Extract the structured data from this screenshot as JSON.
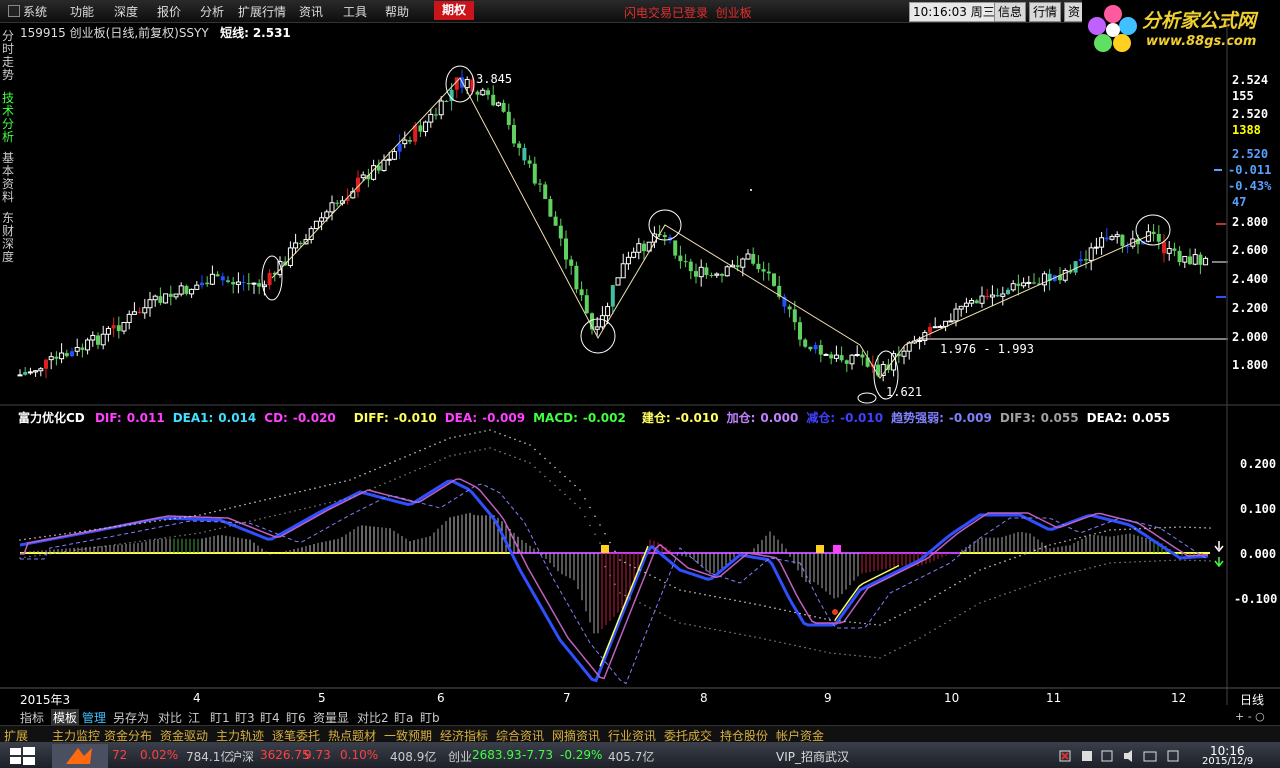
{
  "menu": [
    "系统",
    "功能",
    "深度",
    "报价",
    "分析",
    "扩展行情",
    "资讯",
    "工具",
    "帮助"
  ],
  "menu_qiquan": "期权",
  "status_login": "闪电交易已登录",
  "status_board": "创业板",
  "clock_time": "10:16:03",
  "clock_day": "周三",
  "top_buttons": [
    "信息",
    "行情",
    "资"
  ],
  "logo": {
    "title": "分析家公式网",
    "url": "www.88gs.com"
  },
  "left_tabs": [
    "分时走势",
    "技术分析",
    "基本资料",
    "东财深度"
  ],
  "header": {
    "code": "159915",
    "name": "创业板(日线,前复权)SSYY",
    "label": "短线:",
    "value": "2.531"
  },
  "price_axis": [
    {
      "v": "2.524",
      "c": "#ffffff"
    },
    {
      "v": "155",
      "c": "#ffffff"
    },
    {
      "v": "2.520",
      "c": "#ffffff"
    },
    {
      "v": "1388",
      "c": "#ffff00"
    },
    {
      "v": "2.520",
      "c": "#5aa0ff"
    },
    {
      "v": "-0.011",
      "c": "#5aa0ff"
    },
    {
      "v": "-0.43%",
      "c": "#5aa0ff"
    },
    {
      "v": "47",
      "c": "#5aa0ff"
    },
    {
      "v": "2.800",
      "c": "#ffffff"
    },
    {
      "v": "2.600",
      "c": "#ffffff"
    },
    {
      "v": "2.400",
      "c": "#ffffff"
    },
    {
      "v": "2.200",
      "c": "#ffffff"
    },
    {
      "v": "2.000",
      "c": "#ffffff"
    },
    {
      "v": "1.800",
      "c": "#ffffff"
    }
  ],
  "annotations": {
    "peak": "3.845",
    "low": "1.621",
    "range": "1.976 - 1.993"
  },
  "indicator": {
    "name": "富力优化CD",
    "items": [
      {
        "k": "DIF:",
        "v": "0.011",
        "c": "#ff40ff"
      },
      {
        "k": "DEA1:",
        "v": "0.014",
        "c": "#40e0ff"
      },
      {
        "k": "CD:",
        "v": "-0.020",
        "c": "#ff40ff"
      },
      {
        "k": "DIFF:",
        "v": "-0.010",
        "c": "#ffff60"
      },
      {
        "k": "DEA:",
        "v": "-0.009",
        "c": "#ff40ff"
      },
      {
        "k": "MACD:",
        "v": "-0.002",
        "c": "#40ff40"
      },
      {
        "k": "建仓:",
        "v": "-0.010",
        "c": "#ffff60"
      },
      {
        "k": "加仓:",
        "v": "0.000",
        "c": "#c080ff"
      },
      {
        "k": "减仓:",
        "v": "-0.010",
        "c": "#4040ff"
      },
      {
        "k": "趋势强弱:",
        "v": "-0.009",
        "c": "#8080ff"
      },
      {
        "k": "DIF3:",
        "v": "0.055",
        "c": "#a0a0a0"
      },
      {
        "k": "DEA2:",
        "v": "0.055",
        "c": "#ffffff"
      }
    ],
    "axis": [
      "0.200",
      "0.100",
      "0.000",
      "-0.100"
    ]
  },
  "time_axis": [
    "2015年3",
    "4",
    "5",
    "6",
    "7",
    "8",
    "9",
    "10",
    "11",
    "12"
  ],
  "period": "日线",
  "tabs1": [
    "指标",
    "模板",
    "管理",
    "另存为",
    "对比",
    "江",
    "盯1",
    "盯3",
    "盯4",
    "盯6",
    "资量显",
    "对比2",
    "盯a",
    "盯b"
  ],
  "tabs2": [
    "扩展",
    "主力监控",
    "资金分布",
    "资金驱动",
    "主力轨迹",
    "逐笔委托",
    "热点题材",
    "一致预期",
    "经济指标",
    "综合资讯",
    "网摘资讯",
    "行业资讯",
    "委托成交",
    "持仓股份",
    "帐户资金"
  ],
  "taskbar": {
    "items": [
      {
        "t": "72",
        "c": "#ff4040"
      },
      {
        "t": "0.02%",
        "c": "#ff4040"
      },
      {
        "t": "784.1亿",
        "c": "#cccccc"
      },
      {
        "t": "沪深",
        "c": "#cccccc"
      },
      {
        "t": "3626.75",
        "c": "#ff4040"
      },
      {
        "t": "9.73",
        "c": "#ff4040"
      },
      {
        "t": "0.10%",
        "c": "#ff4040"
      },
      {
        "t": "408.9亿",
        "c": "#cccccc"
      },
      {
        "t": "创业",
        "c": "#cccccc"
      },
      {
        "t": "2683.93",
        "c": "#40ff40"
      },
      {
        "t": "-7.73",
        "c": "#40ff40"
      },
      {
        "t": "-0.29%",
        "c": "#40ff40"
      },
      {
        "t": "405.7亿",
        "c": "#cccccc"
      }
    ],
    "vip": "VIP_招商武汉",
    "time": "10:16",
    "date": "2015/12/9"
  }
}
